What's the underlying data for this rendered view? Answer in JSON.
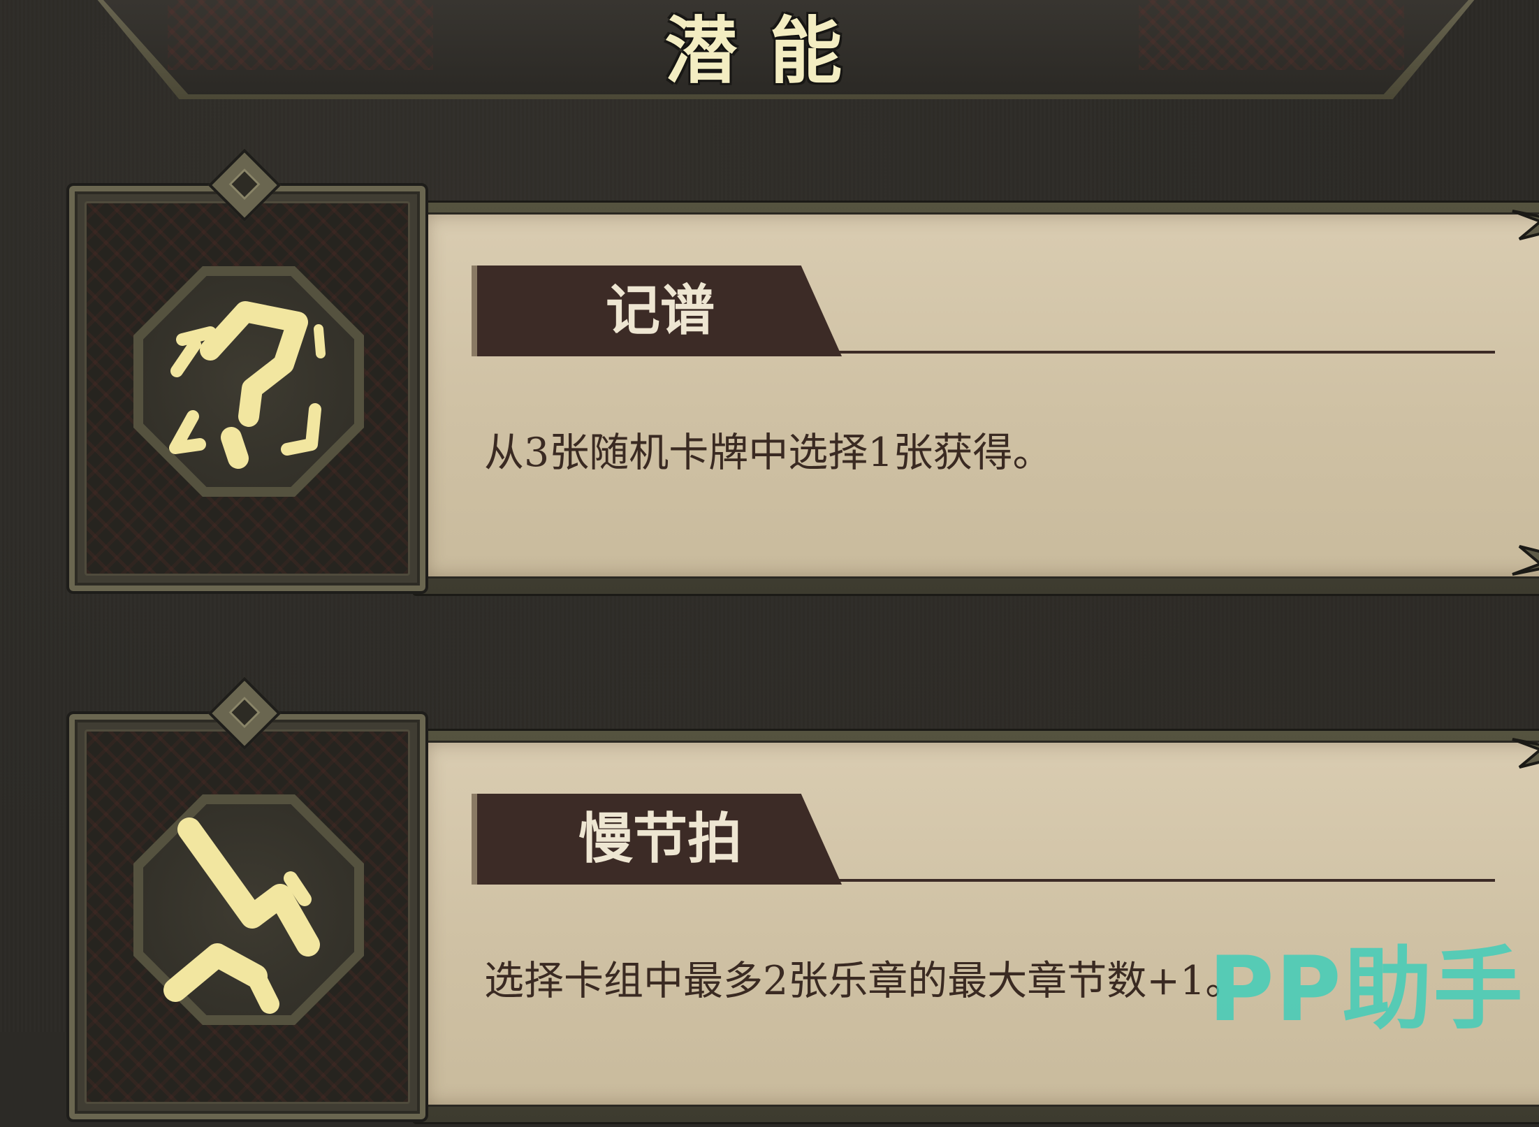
{
  "screen_title": "潜能",
  "talents": [
    {
      "name": "记谱",
      "description": "从3张随机卡牌中选择1张获得。",
      "icon": "question-mark-rune-icon"
    },
    {
      "name": "慢节拍",
      "description": "选择卡组中最多2张乐章的最大章节数+1。",
      "icon": "zigzag-rune-icon"
    }
  ],
  "watermark": "PP助手",
  "colors": {
    "background": "#2c2a26",
    "parchment": "#d4c6a9",
    "tab": "#3c2b26",
    "glyph": "#f2e6a0",
    "title_text": "#f3edc2",
    "watermark": "#3ccdb9"
  }
}
